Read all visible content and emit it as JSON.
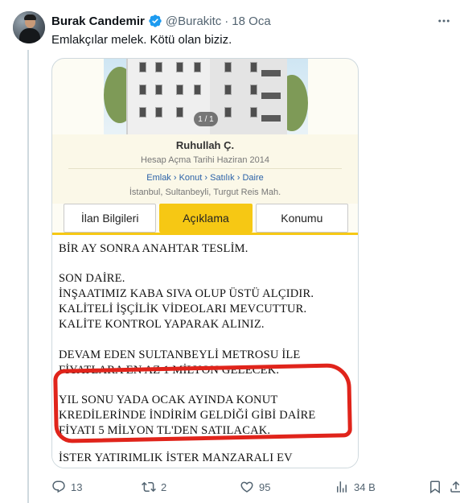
{
  "author": {
    "name": "Burak Candemir",
    "handle": "@Burakitc",
    "dot": "·",
    "date": "18 Oca",
    "verified": true
  },
  "tweet": {
    "text": "Emlakçılar melek. Kötü olan biziz."
  },
  "listing": {
    "photo_counter": "1 / 1",
    "user_name": "Ruhullah Ç.",
    "join_date": "Hesap Açma Tarihi Haziran 2014",
    "breadcrumb": "Emlak › Konut › Satılık › Daire",
    "location": "İstanbul, Sultanbeyli, Turgut Reis Mah.",
    "tabs": [
      {
        "label": "İlan Bilgileri",
        "active": false
      },
      {
        "label": "Açıklama",
        "active": true
      },
      {
        "label": "Konumu",
        "active": false
      }
    ],
    "description_lines": [
      "BİR AY SONRA ANAHTAR TESLİM.",
      "SON DAİRE.",
      "İNŞAATIMIZ KABA SIVA OLUP ÜSTÜ ALÇIDIR.",
      "KALİTELİ İŞÇİLİK VİDEOLARI MEVCUTTUR.",
      "KALİTE KONTROL YAPARAK ALINIZ.",
      "DEVAM EDEN SULTANBEYLİ METROSU İLE",
      "FİYATLARA EN AZ 1 MİLYON GELECEK.",
      "YIL SONU YADA OCAK AYINDA KONUT",
      "KREDİLERİNDE İNDİRİM GELDİĞİ GİBİ DAİRE",
      "FİYATI 5 MİLYON TL'DEN SATILACAK.",
      "İSTER YATIRIMLIK İSTER MANZARALI EV"
    ],
    "accent_color": "#f6c814",
    "highlight_color": "#e0241b"
  },
  "actions": {
    "replies": "13",
    "reposts": "2",
    "likes": "95",
    "views": "34 B"
  }
}
